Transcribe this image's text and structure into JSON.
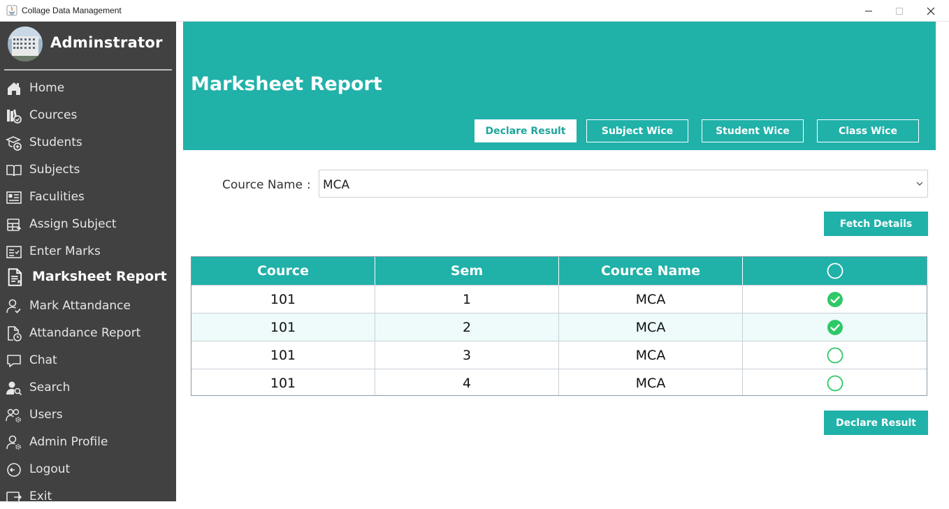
{
  "window": {
    "title": "Collage Data Management"
  },
  "sidebar": {
    "admin_name": "Adminstrator",
    "items": [
      {
        "label": "Home",
        "icon": "home-icon"
      },
      {
        "label": "Cources",
        "icon": "books-check-icon"
      },
      {
        "label": "Students",
        "icon": "student-add-icon"
      },
      {
        "label": "Subjects",
        "icon": "open-book-icon"
      },
      {
        "label": "Faculities",
        "icon": "id-card-icon"
      },
      {
        "label": "Assign Subject",
        "icon": "assign-table-icon"
      },
      {
        "label": "Enter Marks",
        "icon": "marks-form-icon"
      },
      {
        "label": "Marksheet Report",
        "icon": "report-document-icon",
        "active": true
      },
      {
        "label": "Mark Attandance",
        "icon": "person-check-icon"
      },
      {
        "label": "Attandance Report",
        "icon": "document-clock-icon"
      },
      {
        "label": "Chat",
        "icon": "chat-bubble-icon"
      },
      {
        "label": "Search",
        "icon": "person-search-icon"
      },
      {
        "label": "Users",
        "icon": "users-gear-icon"
      },
      {
        "label": "Admin Profile",
        "icon": "admin-gear-icon"
      },
      {
        "label": "Logout",
        "icon": "logout-icon"
      },
      {
        "label": "Exit",
        "icon": "exit-icon"
      }
    ]
  },
  "header": {
    "title": "Marksheet Report",
    "tabs": [
      {
        "label": "Declare Result",
        "active": true
      },
      {
        "label": "Subject Wice",
        "active": false
      },
      {
        "label": "Student Wice",
        "active": false
      },
      {
        "label": "Class Wice",
        "active": false
      }
    ]
  },
  "form": {
    "label": "Cource Name",
    "colon": ":",
    "selected": "MCA",
    "fetch_button": "Fetch Details"
  },
  "table": {
    "columns": [
      "Cource",
      "Sem",
      "Cource Name"
    ],
    "rows": [
      {
        "cource": "101",
        "sem": "1",
        "cource_name": "MCA",
        "checked": true
      },
      {
        "cource": "101",
        "sem": "2",
        "cource_name": "MCA",
        "checked": true
      },
      {
        "cource": "101",
        "sem": "3",
        "cource_name": "MCA",
        "checked": false
      },
      {
        "cource": "101",
        "sem": "4",
        "cource_name": "MCA",
        "checked": false
      }
    ]
  },
  "actions": {
    "declare_button": "Declare Result"
  },
  "colors": {
    "accent": "#20b1a9",
    "sidebar": "#414141",
    "check": "#2ec866"
  }
}
